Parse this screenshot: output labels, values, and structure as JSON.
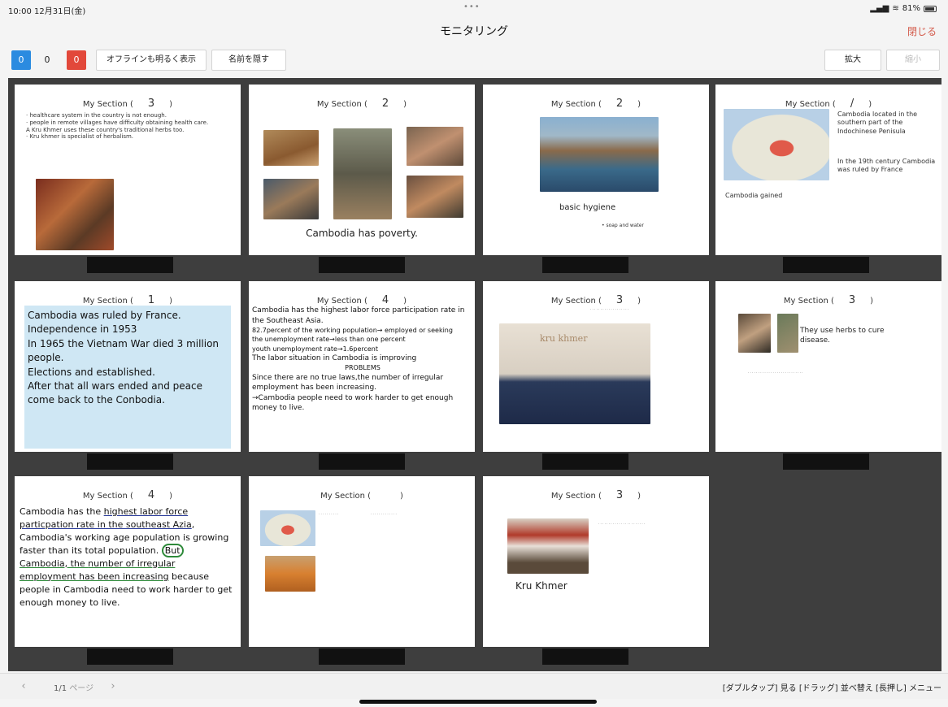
{
  "status": {
    "time": "10:00",
    "date": "12月31日(金)",
    "battery": "81%"
  },
  "header": {
    "title": "モニタリング",
    "close_label": "閉じる",
    "dots": "•••"
  },
  "toolbar": {
    "count_blue": "0",
    "count_plain": "0",
    "count_red": "0",
    "offline_label": "オフラインも明るく表示",
    "names_label": "名前を隠す",
    "zoom_in_label": "拡大",
    "zoom_out_label": "縮小"
  },
  "cards": [
    {
      "section_label": "My Section (",
      "number": "3",
      "lines": [
        "· healthcare system in the country is not enough.",
        "· people in remote villages have difficulty obtaining health care.",
        "A Kru Khmer uses these country's traditional herbs too.",
        "· Kru khmer is specialist of herbalism."
      ]
    },
    {
      "section_label": "My Section (",
      "number": "2",
      "caption": "Cambodia has poverty."
    },
    {
      "section_label": "My Section (",
      "number": "2",
      "caption": "basic hygiene",
      "note": "• soap and water"
    },
    {
      "section_label": "My Section (",
      "number": "/",
      "text1": "Cambodia located in the southern part of the Indochinese Penisula",
      "text2": "In the 19th century Cambodia was ruled by France",
      "text3": "Cambodia gained"
    },
    {
      "section_label": "My Section (",
      "number": "1",
      "lines": [
        "Cambodia was ruled by France.",
        "Independence in 1953",
        "In 1965 the Vietnam War died 3 million people.",
        "Elections and established.",
        "After that all wars ended and peace come back to the Conbodia."
      ]
    },
    {
      "section_label": "My Section (",
      "number": "4",
      "lines": [
        "Cambodia has the highest labor force participation rate in the Southeast Asia.",
        "82.7percent of the working population→ employed or seeking",
        "the unemployment rate→less than one percent",
        "youth unemployment rate→1.6percent",
        "The labor situation in Cambodia is improving",
        "PROBLEMS",
        "Since there are no true laws,the number of irregular employment has been increasing.",
        "→Cambodia people need to work harder to get enough money to live."
      ]
    },
    {
      "section_label": "My Section (",
      "number": "3",
      "banner": "kru khmer"
    },
    {
      "section_label": "My Section (",
      "number": "3",
      "caption": "They use herbs to cure disease."
    },
    {
      "section_label": "My Section (",
      "number": "4",
      "p1": "Cambodia has the ",
      "p2": "highest labor force particpation rate in the southeast Azia",
      "p3": ", Cambodia's working age population is growing faster than its total population.",
      "p4": "But",
      "p5": " Cambodia, the ",
      "p6": "number of irregular employment has been increasing",
      "p7": " because people in Cambodia need to work harder to get enough money to live."
    },
    {
      "section_label": "My Section (",
      "number": ""
    },
    {
      "section_label": "My Section (",
      "number": "3",
      "caption": "Kru Khmer"
    }
  ],
  "footer": {
    "prev": "‹",
    "next": "›",
    "page": "1/1",
    "page_unit": "ページ",
    "hint": "[ダブルタップ] 見る [ドラッグ] 並べ替え [長押し] メニュー"
  }
}
